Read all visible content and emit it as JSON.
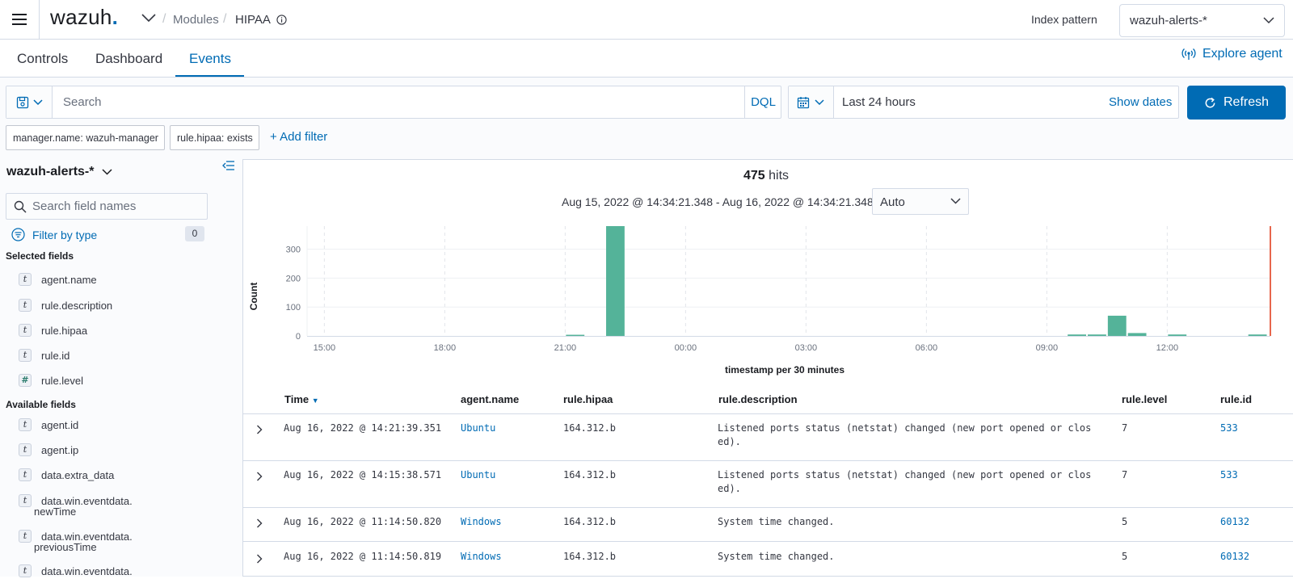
{
  "header": {
    "logo_text": "wazuh",
    "logo_dot": ".",
    "breadcrumb_modules": "Modules",
    "breadcrumb_separator": "/",
    "breadcrumb_current": "HIPAA",
    "index_pattern_label": "Index pattern",
    "index_pattern_value": "wazuh-alerts-*"
  },
  "tabs": [
    {
      "label": "Controls"
    },
    {
      "label": "Dashboard"
    },
    {
      "label": "Events",
      "active": true
    }
  ],
  "explore_agent": "Explore agent",
  "query": {
    "placeholder": "Search",
    "language": "DQL"
  },
  "time": {
    "range_label": "Last 24 hours",
    "show_dates": "Show dates",
    "refresh_label": "Refresh"
  },
  "filters": {
    "pills": [
      "manager.name: wazuh-manager",
      "rule.hipaa: exists"
    ],
    "add_filter": "+ Add filter"
  },
  "sidebar": {
    "index_pattern": "wazuh-alerts-*",
    "search_placeholder": "Search field names",
    "filter_by_type": "Filter by type",
    "filter_count": "0",
    "selected_title": "Selected fields",
    "selected_fields": [
      {
        "type": "t",
        "name": "agent.name"
      },
      {
        "type": "t",
        "name": "rule.description"
      },
      {
        "type": "t",
        "name": "rule.hipaa"
      },
      {
        "type": "t",
        "name": "rule.id"
      },
      {
        "type": "#",
        "name": "rule.level"
      }
    ],
    "available_title": "Available fields",
    "available_fields": [
      {
        "type": "t",
        "name": "agent.id"
      },
      {
        "type": "t",
        "name": "agent.ip"
      },
      {
        "type": "t",
        "name": "data.extra_data"
      },
      {
        "type": "t",
        "name_line1": "data.win.eventdata.",
        "name_line2": "newTime"
      },
      {
        "type": "t",
        "name_line1": "data.win.eventdata.",
        "name_line2": "previousTime"
      },
      {
        "type": "t",
        "name_line1": "data.win.eventdata."
      }
    ]
  },
  "discover": {
    "hits_count": "475",
    "hits_label": "hits",
    "time_range": "Aug 15, 2022 @ 14:34:21.348 - Aug 16, 2022 @ 14:34:21.348",
    "interval": "Auto"
  },
  "chart_data": {
    "type": "bar",
    "xlabel": "timestamp per 30 minutes",
    "ylabel": "Count",
    "ylim": [
      0,
      380
    ],
    "y_ticks": [
      0,
      100,
      200,
      300
    ],
    "x_ticks": [
      "15:00",
      "18:00",
      "21:00",
      "00:00",
      "03:00",
      "06:00",
      "09:00",
      "12:00"
    ],
    "x_tick_hours": [
      15,
      18,
      21,
      24,
      27,
      30,
      33,
      36
    ],
    "x_domain_hours": [
      14.57,
      38.57
    ],
    "bars": [
      {
        "start_hour": 21.0,
        "value": 4
      },
      {
        "start_hour": 22.0,
        "value": 380
      },
      {
        "start_hour": 33.5,
        "value": 5
      },
      {
        "start_hour": 34.0,
        "value": 5
      },
      {
        "start_hour": 34.5,
        "value": 70
      },
      {
        "start_hour": 35.0,
        "value": 10
      },
      {
        "start_hour": 36.0,
        "value": 5
      },
      {
        "start_hour": 38.0,
        "value": 5
      }
    ],
    "bar_width_hours": 0.5,
    "now_marker_hour": 38.57,
    "grid": true,
    "bar_color": "#54b399",
    "marker_color": "#e7664c"
  },
  "table": {
    "columns": [
      "Time",
      "agent.name",
      "rule.hipaa",
      "rule.description",
      "rule.level",
      "rule.id"
    ],
    "rows": [
      {
        "time": "Aug 16, 2022 @ 14:21:39.351",
        "agent": "Ubuntu",
        "hipaa": "164.312.b",
        "desc1": "Listened ports status (netstat) changed (new port opened or clos",
        "desc2": "ed).",
        "level": "7",
        "id": "533"
      },
      {
        "time": "Aug 16, 2022 @ 14:15:38.571",
        "agent": "Ubuntu",
        "hipaa": "164.312.b",
        "desc1": "Listened ports status (netstat) changed (new port opened or clos",
        "desc2": "ed).",
        "level": "7",
        "id": "533"
      },
      {
        "time": "Aug 16, 2022 @ 11:14:50.820",
        "agent": "Windows",
        "hipaa": "164.312.b",
        "desc1": "System time changed.",
        "desc2": "",
        "level": "5",
        "id": "60132"
      },
      {
        "time": "Aug 16, 2022 @ 11:14:50.819",
        "agent": "Windows",
        "hipaa": "164.312.b",
        "desc1": "System time changed.",
        "desc2": "",
        "level": "5",
        "id": "60132"
      }
    ]
  },
  "colors": {
    "accent": "#006bb4",
    "border": "#d3dae6",
    "text": "#343741"
  }
}
